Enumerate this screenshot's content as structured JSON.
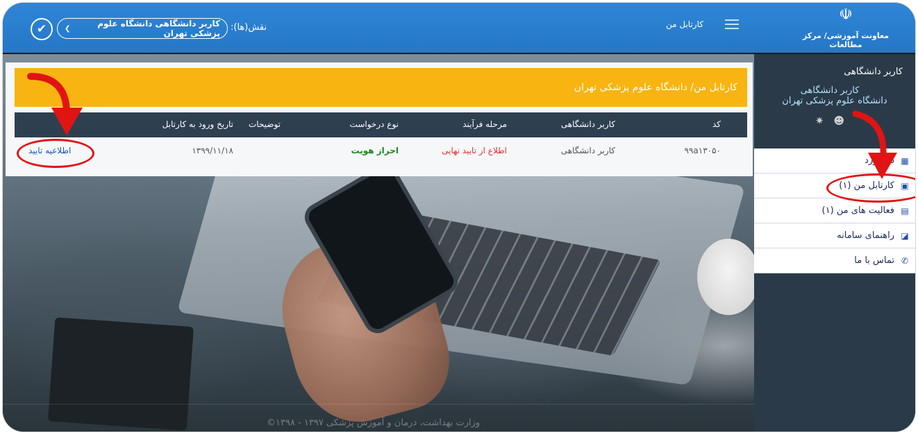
{
  "header": {
    "logo_caption": "معاونت آموزشی/ مرکز مطالعات",
    "menu_link": "کارتابل من",
    "role_label": "نقش(ها):",
    "role_value": "کاربر دانشگاهی دانشگاه علوم پزشکی تهران",
    "confirm_symbol": "✔"
  },
  "sidebar": {
    "user_title": "کاربر دانشگاهی",
    "user_role": "کاربر دانشگاهی",
    "user_org": "دانشگاه علوم پزشکی تهران",
    "items": [
      {
        "label": "داشبورد",
        "icon": "dashboard-icon"
      },
      {
        "label": "کارتابل من (۱)",
        "icon": "inbox-icon"
      },
      {
        "label": "فعالیت های من (۱)",
        "icon": "id-card-icon"
      },
      {
        "label": "راهنمای سامانه",
        "icon": "book-icon"
      },
      {
        "label": "تماس با ما",
        "icon": "phone-icon"
      }
    ]
  },
  "panel": {
    "title": "کارتابل من/ دانشگاه علوم پزشکی تهران",
    "columns": {
      "code": "کد",
      "user": "کاربر دانشگاهی",
      "stage": "مرحله فرآیند",
      "type": "نوع درخواست",
      "desc": "توضیحات",
      "date": "تاریخ ورود به کارتابل"
    },
    "row": {
      "code": "۹۹a۱۳۰۵۰",
      "user": "کاربر دانشگاهی",
      "stage": "اطلاع از تایید نهایی",
      "type": "احراز هویت",
      "desc": "",
      "date": "۱۳۹۹/۱۱/۱۸",
      "action": "اطلاعیه تایید"
    }
  },
  "footer": {
    "text": "وزارت بهداشت، درمان و آموزش پزشکی ۱۳۹۷ - ۱۳۹۸©"
  },
  "colors": {
    "topbar": "#2f86d6",
    "panel_header": "#f8b410",
    "table_header": "#2e3f50",
    "sidebar": "#2b3a48",
    "annotation": "#e11414"
  }
}
